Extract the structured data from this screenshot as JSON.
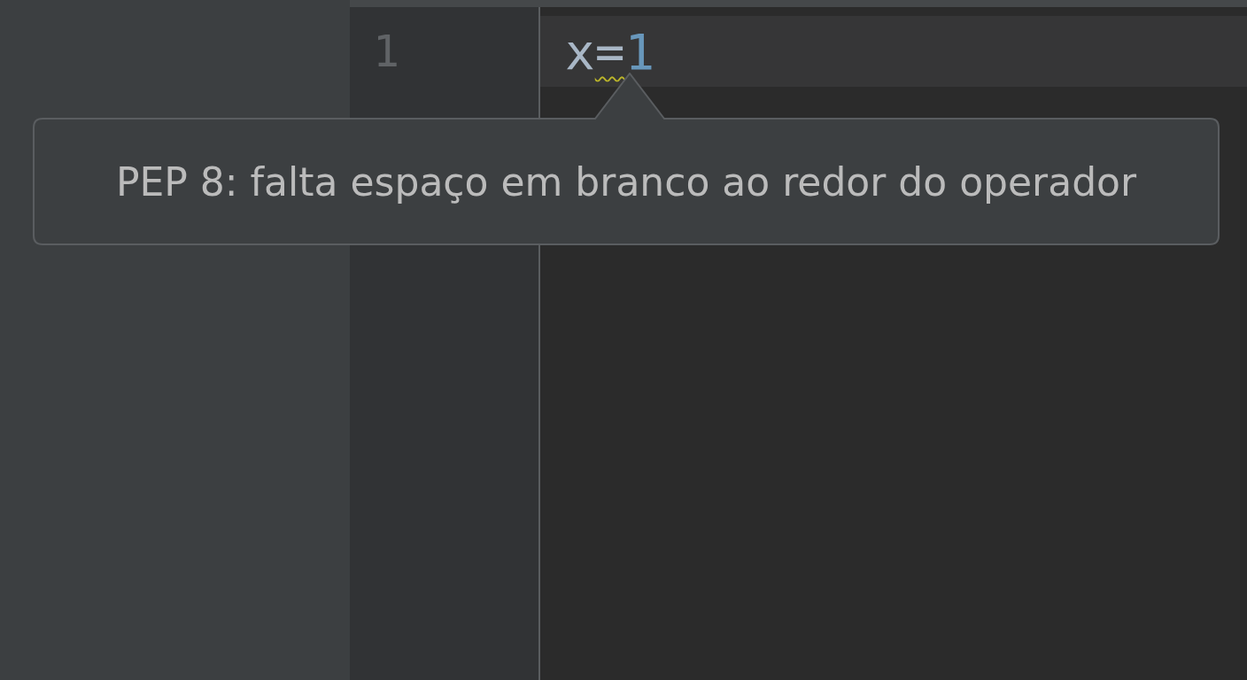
{
  "editor": {
    "lines": [
      {
        "number": "1",
        "current": true,
        "tokens": [
          {
            "kind": "identifier",
            "text": "x",
            "warning": false
          },
          {
            "kind": "operator",
            "text": "=",
            "warning": true
          },
          {
            "kind": "number",
            "text": "1",
            "warning": false
          }
        ]
      }
    ]
  },
  "tooltip": {
    "text": "PEP 8: falta espaço em branco ao redor do operador"
  }
}
